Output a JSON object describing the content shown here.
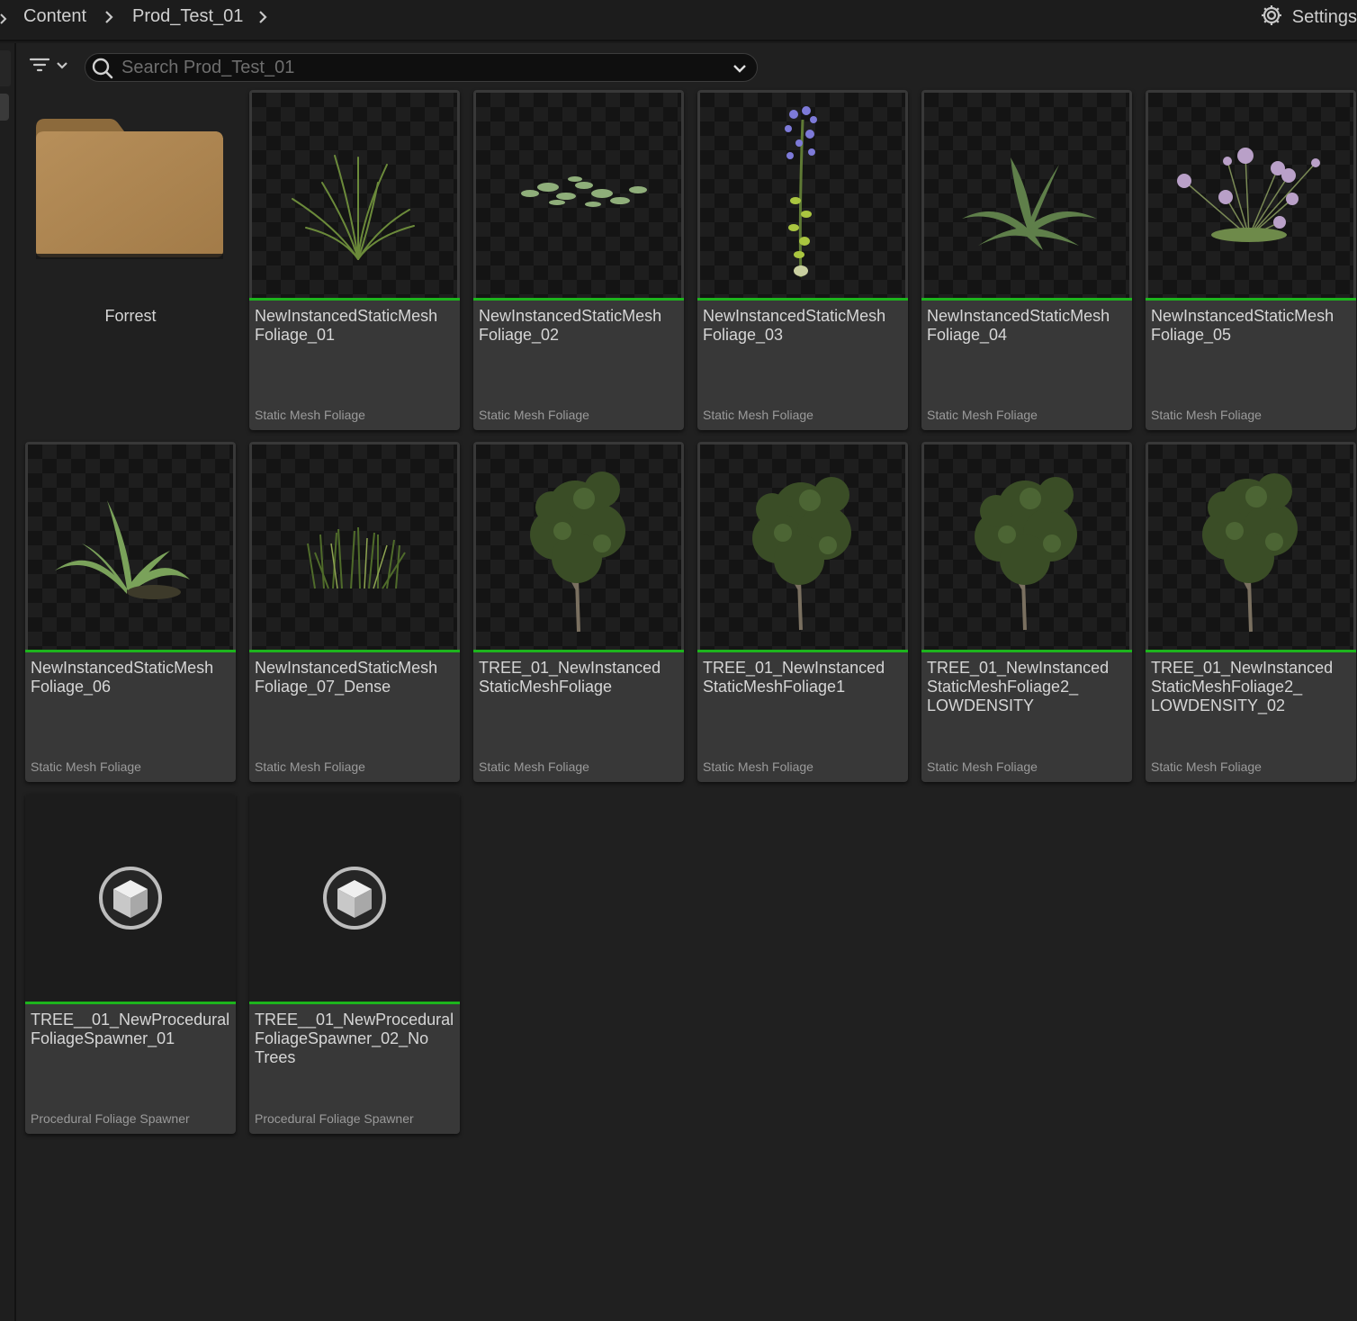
{
  "breadcrumb": {
    "items": [
      "Content",
      "Prod_Test_01"
    ]
  },
  "settings": {
    "label": "Settings"
  },
  "search": {
    "placeholder": "Search Prod_Test_01",
    "value": ""
  },
  "folders": [
    {
      "name": "Forrest"
    }
  ],
  "assets": [
    {
      "name": "NewInstancedStaticMesh\nFoliage_01",
      "type": "Static Mesh Foliage",
      "thumb": "grass-tuft"
    },
    {
      "name": "NewInstancedStaticMesh\nFoliage_02",
      "type": "Static Mesh Foliage",
      "thumb": "ground-leaves"
    },
    {
      "name": "NewInstancedStaticMesh\nFoliage_03",
      "type": "Static Mesh Foliage",
      "thumb": "blue-flower"
    },
    {
      "name": "NewInstancedStaticMesh\nFoliage_04",
      "type": "Static Mesh Foliage",
      "thumb": "fern-bush"
    },
    {
      "name": "NewInstancedStaticMesh\nFoliage_05",
      "type": "Static Mesh Foliage",
      "thumb": "purple-flowers"
    },
    {
      "name": "NewInstancedStaticMesh\nFoliage_06",
      "type": "Static Mesh Foliage",
      "thumb": "fern"
    },
    {
      "name": "NewInstancedStaticMesh\nFoliage_07_Dense",
      "type": "Static Mesh Foliage",
      "thumb": "dense-grass"
    },
    {
      "name": "TREE_01_NewInstanced\nStaticMeshFoliage",
      "type": "Static Mesh Foliage",
      "thumb": "tree"
    },
    {
      "name": "TREE_01_NewInstanced\nStaticMeshFoliage1",
      "type": "Static Mesh Foliage",
      "thumb": "tree"
    },
    {
      "name": "TREE_01_NewInstanced\nStaticMeshFoliage2_\nLOWDENSITY",
      "type": "Static Mesh Foliage",
      "thumb": "tree"
    },
    {
      "name": "TREE_01_NewInstanced\nStaticMeshFoliage2_\nLOWDENSITY_02",
      "type": "Static Mesh Foliage",
      "thumb": "tree"
    },
    {
      "name": "TREE__01_NewProcedural\nFoliageSpawner_01",
      "type": "Procedural Foliage Spawner",
      "thumb": "spawner-cube"
    },
    {
      "name": "TREE__01_NewProcedural\nFoliageSpawner_02_No\nTrees",
      "type": "Procedural Foliage Spawner",
      "thumb": "spawner-cube"
    }
  ],
  "colors": {
    "accent_bar": "#1db41d",
    "folder": "#b08a55",
    "background": "#202020"
  }
}
